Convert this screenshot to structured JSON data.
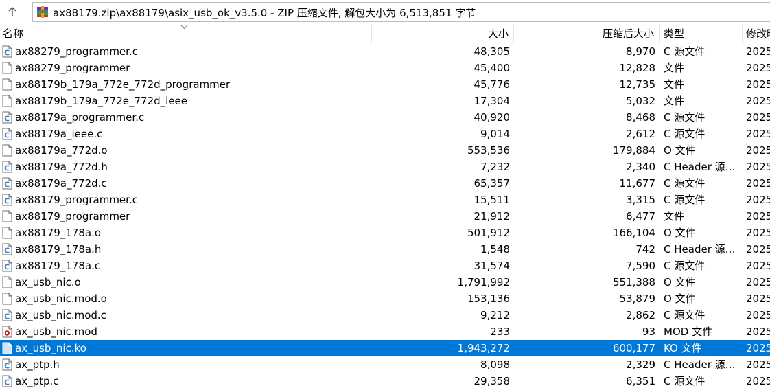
{
  "window": {
    "path": "ax88179.zip\\ax88179\\asix_usb_ok_v3.5.0 - ZIP 压缩文件, 解包大小为 6,513,851 字节"
  },
  "columns": {
    "name": "名称",
    "size": "大小",
    "packed": "压缩后大小",
    "type": "类型",
    "modified": "修改时"
  },
  "icons": {
    "up": "arrow-up-icon",
    "archive": "winrar-archive-icon",
    "c_file": "c-source-file-icon",
    "blank_file": "blank-file-icon",
    "mod_file": "mod-file-icon",
    "ko_file": "ko-file-icon"
  },
  "colors": {
    "selection": "#0078d7",
    "c_icon": "#3c82d2"
  },
  "files": [
    {
      "name": "ax88279_programmer.c",
      "size": "48,305",
      "packed": "8,970",
      "type": "C 源文件",
      "modified": "2025",
      "icon": "c"
    },
    {
      "name": "ax88279_programmer",
      "size": "45,400",
      "packed": "12,828",
      "type": "文件",
      "modified": "2025",
      "icon": "blank"
    },
    {
      "name": "ax88179b_179a_772e_772d_programmer",
      "size": "45,776",
      "packed": "12,735",
      "type": "文件",
      "modified": "2025",
      "icon": "blank"
    },
    {
      "name": "ax88179b_179a_772e_772d_ieee",
      "size": "17,304",
      "packed": "5,032",
      "type": "文件",
      "modified": "2025",
      "icon": "blank"
    },
    {
      "name": "ax88179a_programmer.c",
      "size": "40,920",
      "packed": "8,468",
      "type": "C 源文件",
      "modified": "2025",
      "icon": "c"
    },
    {
      "name": "ax88179a_ieee.c",
      "size": "9,014",
      "packed": "2,612",
      "type": "C 源文件",
      "modified": "2025",
      "icon": "c"
    },
    {
      "name": "ax88179a_772d.o",
      "size": "553,536",
      "packed": "179,884",
      "type": "O 文件",
      "modified": "2025",
      "icon": "blank"
    },
    {
      "name": "ax88179a_772d.h",
      "size": "7,232",
      "packed": "2,340",
      "type": "C Header 源文件",
      "modified": "2025",
      "icon": "c"
    },
    {
      "name": "ax88179a_772d.c",
      "size": "65,357",
      "packed": "11,677",
      "type": "C 源文件",
      "modified": "2025",
      "icon": "c"
    },
    {
      "name": "ax88179_programmer.c",
      "size": "15,511",
      "packed": "3,315",
      "type": "C 源文件",
      "modified": "2025",
      "icon": "c"
    },
    {
      "name": "ax88179_programmer",
      "size": "21,912",
      "packed": "6,477",
      "type": "文件",
      "modified": "2025",
      "icon": "blank"
    },
    {
      "name": "ax88179_178a.o",
      "size": "501,912",
      "packed": "166,104",
      "type": "O 文件",
      "modified": "2025",
      "icon": "blank"
    },
    {
      "name": "ax88179_178a.h",
      "size": "1,548",
      "packed": "742",
      "type": "C Header 源文件",
      "modified": "2025",
      "icon": "c"
    },
    {
      "name": "ax88179_178a.c",
      "size": "31,574",
      "packed": "7,590",
      "type": "C 源文件",
      "modified": "2025",
      "icon": "c"
    },
    {
      "name": "ax_usb_nic.o",
      "size": "1,791,992",
      "packed": "551,388",
      "type": "O 文件",
      "modified": "2025",
      "icon": "blank"
    },
    {
      "name": "ax_usb_nic.mod.o",
      "size": "153,136",
      "packed": "53,879",
      "type": "O 文件",
      "modified": "2025",
      "icon": "blank"
    },
    {
      "name": "ax_usb_nic.mod.c",
      "size": "9,212",
      "packed": "2,862",
      "type": "C 源文件",
      "modified": "2025",
      "icon": "c"
    },
    {
      "name": "ax_usb_nic.mod",
      "size": "233",
      "packed": "93",
      "type": "MOD 文件",
      "modified": "2025",
      "icon": "mod"
    },
    {
      "name": "ax_usb_nic.ko",
      "size": "1,943,272",
      "packed": "600,177",
      "type": "KO 文件",
      "modified": "2025",
      "icon": "ko",
      "selected": true
    },
    {
      "name": "ax_ptp.h",
      "size": "8,098",
      "packed": "2,329",
      "type": "C Header 源文件",
      "modified": "2025",
      "icon": "c"
    },
    {
      "name": "ax_ptp.c",
      "size": "29,358",
      "packed": "6,351",
      "type": "C 源文件",
      "modified": "2025",
      "icon": "c"
    }
  ]
}
